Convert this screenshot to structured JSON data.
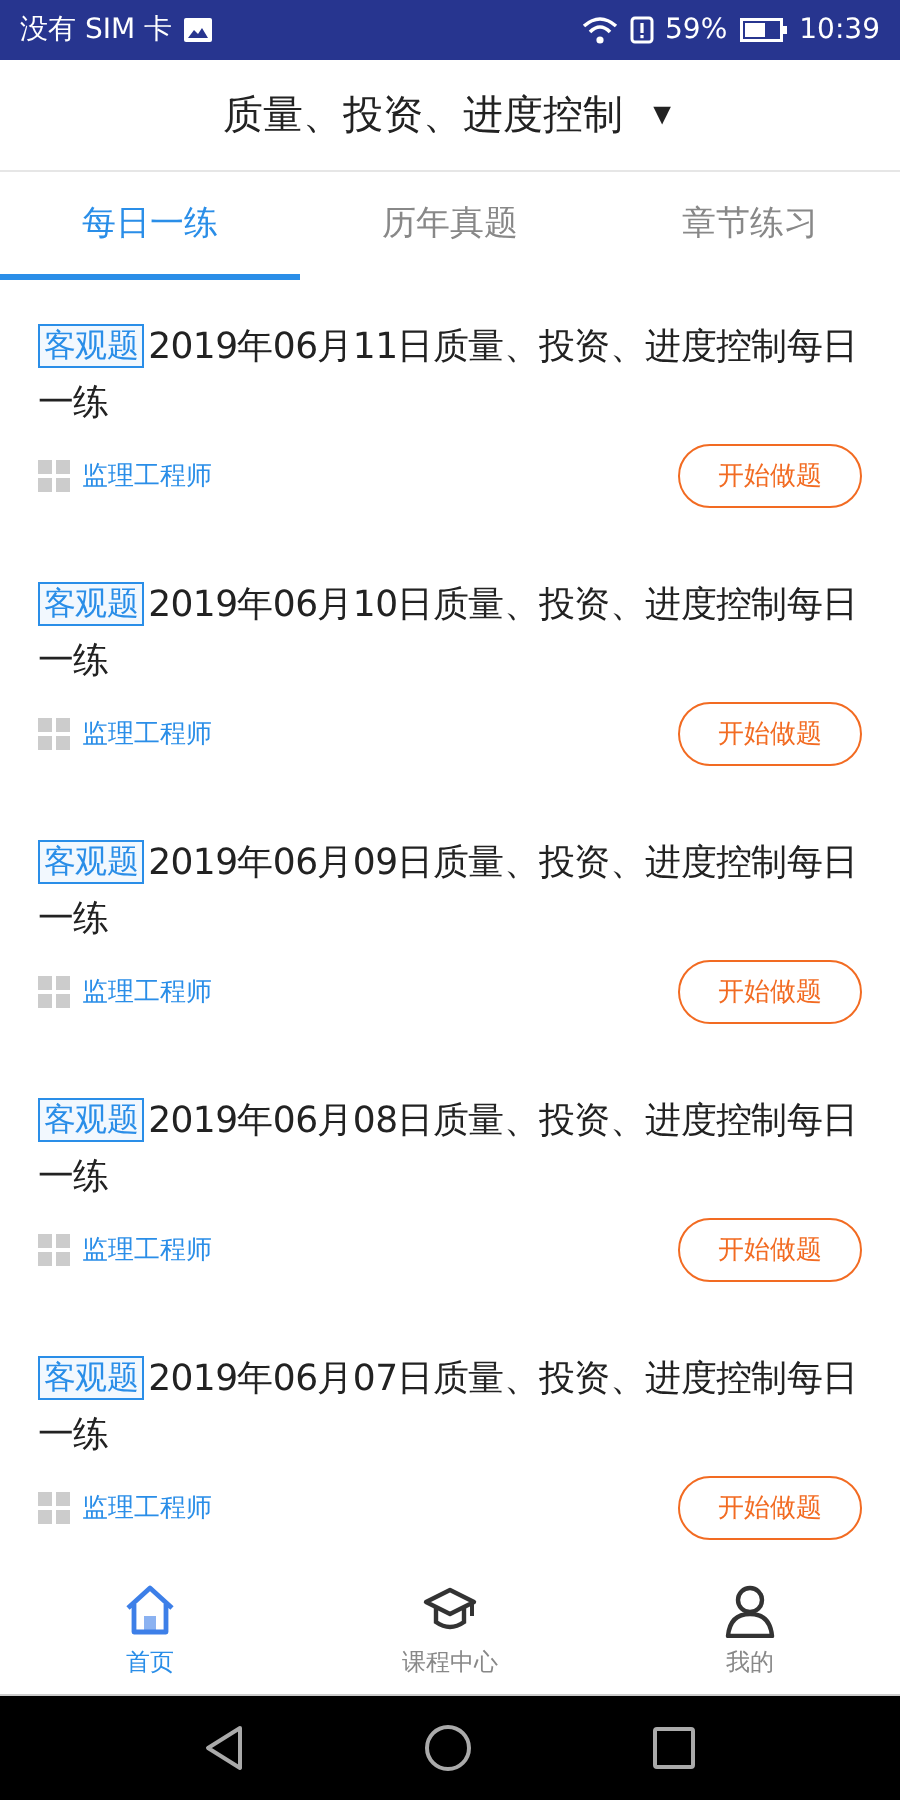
{
  "status_bar": {
    "carrier": "没有 SIM 卡",
    "battery": "59%",
    "time": "10:39"
  },
  "header": {
    "title": "质量、投资、进度控制",
    "dropdown": "▼"
  },
  "tabs": [
    {
      "label": "每日一练",
      "selected": true
    },
    {
      "label": "历年真题",
      "selected": false
    },
    {
      "label": "章节练习",
      "selected": false
    }
  ],
  "items": [
    {
      "tag": "客观题",
      "title": "2019年06月11日质量、投资、进度控制每日一练",
      "category": "监理工程师",
      "action": "开始做题"
    },
    {
      "tag": "客观题",
      "title": "2019年06月10日质量、投资、进度控制每日一练",
      "category": "监理工程师",
      "action": "开始做题"
    },
    {
      "tag": "客观题",
      "title": "2019年06月09日质量、投资、进度控制每日一练",
      "category": "监理工程师",
      "action": "开始做题"
    },
    {
      "tag": "客观题",
      "title": "2019年06月08日质量、投资、进度控制每日一练",
      "category": "监理工程师",
      "action": "开始做题"
    },
    {
      "tag": "客观题",
      "title": "2019年06月07日质量、投资、进度控制每日一练",
      "category": "监理工程师",
      "action": "开始做题"
    }
  ],
  "bottom_nav": [
    {
      "label": "首页",
      "kind": "home",
      "selected": true
    },
    {
      "label": "课程中心",
      "kind": "cap",
      "selected": false
    },
    {
      "label": "我的",
      "kind": "person",
      "selected": false
    }
  ]
}
